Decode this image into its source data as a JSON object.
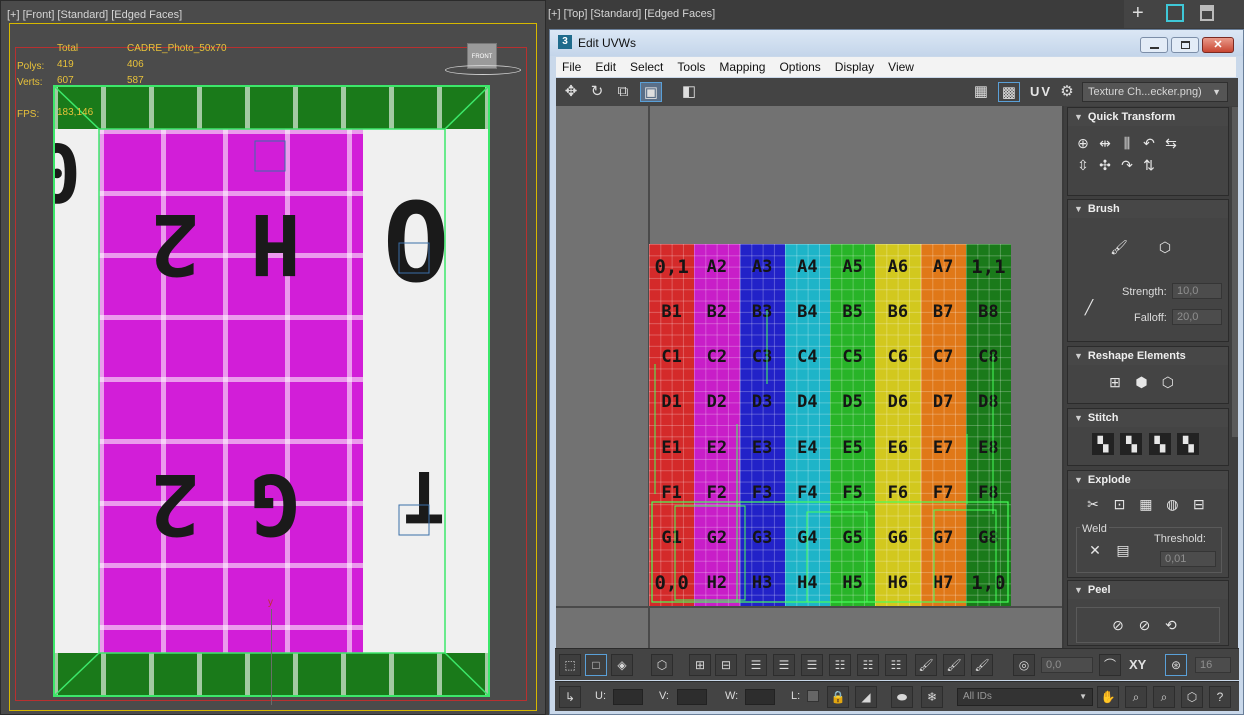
{
  "viewport_left": {
    "title": "[+] [Front] [Standard] [Edged Faces]",
    "stats": {
      "total_label": "Total",
      "object_name": "CADRE_Photo_50x70",
      "polys_label": "Polys:",
      "polys_total": "419",
      "polys_obj": "406",
      "verts_label": "Verts:",
      "verts_total": "607",
      "verts_obj": "587",
      "fps_label": "FPS:",
      "fps_value": "183,146"
    },
    "viewcube_label": "FRONT",
    "axis_label": "y"
  },
  "viewport_right_title": "[+] [Top] [Standard] [Edged Faces]",
  "top_right_icons": [
    "plus-icon",
    "maximize-icon",
    "brush-icon"
  ],
  "window": {
    "title": "Edit UVWs",
    "app_badge": "3",
    "menu": [
      "File",
      "Edit",
      "Select",
      "Tools",
      "Mapping",
      "Options",
      "Display",
      "View"
    ],
    "uv_label": "UV",
    "texture_dropdown": "Texture Ch...ecker.png)"
  },
  "checker": {
    "rows": [
      "0,1 A2 A3 A4 A5 A6 A7 1,1",
      "B1 B2 B3 B4 B5 B6 B7 B8",
      "C1 C2 C3 C4 C5 C6 C7 C8",
      "D1 D2 D3 D4 D5 D6 D7 D8",
      "E1 E2 E3 E4 E5 E6 E7 E8",
      "F1 F2 F3 F4 F5 F6 F7 F8",
      "G1 G2 G3 G4 G5 G6 G7 G8",
      "0,0 H2 H3 H4 H5 H6 H7 1,0"
    ],
    "column_colors": [
      "#d42a2a",
      "#c81ec8",
      "#2222c8",
      "#1eb4c8",
      "#28b428",
      "#d2c81e",
      "#e07818",
      "#1a7a1a"
    ],
    "left_columns": [
      6,
      1,
      0,
      1,
      6,
      1,
      0
    ],
    "left_row_labels": [
      "0",
      "H 2",
      "O",
      "G 2",
      "T"
    ]
  },
  "panels": {
    "quick_transform": "Quick Transform",
    "brush": "Brush",
    "strength_label": "Strength:",
    "strength_value": "10,0",
    "falloff_label": "Falloff:",
    "falloff_value": "20,0",
    "reshape": "Reshape Elements",
    "stitch": "Stitch",
    "explode": "Explode",
    "weld": "Weld",
    "threshold_label": "Threshold:",
    "threshold_value": "0,01",
    "peel": "Peel"
  },
  "bottom": {
    "value1": "0,0",
    "xy_label": "XY",
    "value2": "16",
    "u_label": "U:",
    "v_label": "V:",
    "w_label": "W:",
    "l_label": "L:",
    "ids_dropdown": "All IDs"
  }
}
